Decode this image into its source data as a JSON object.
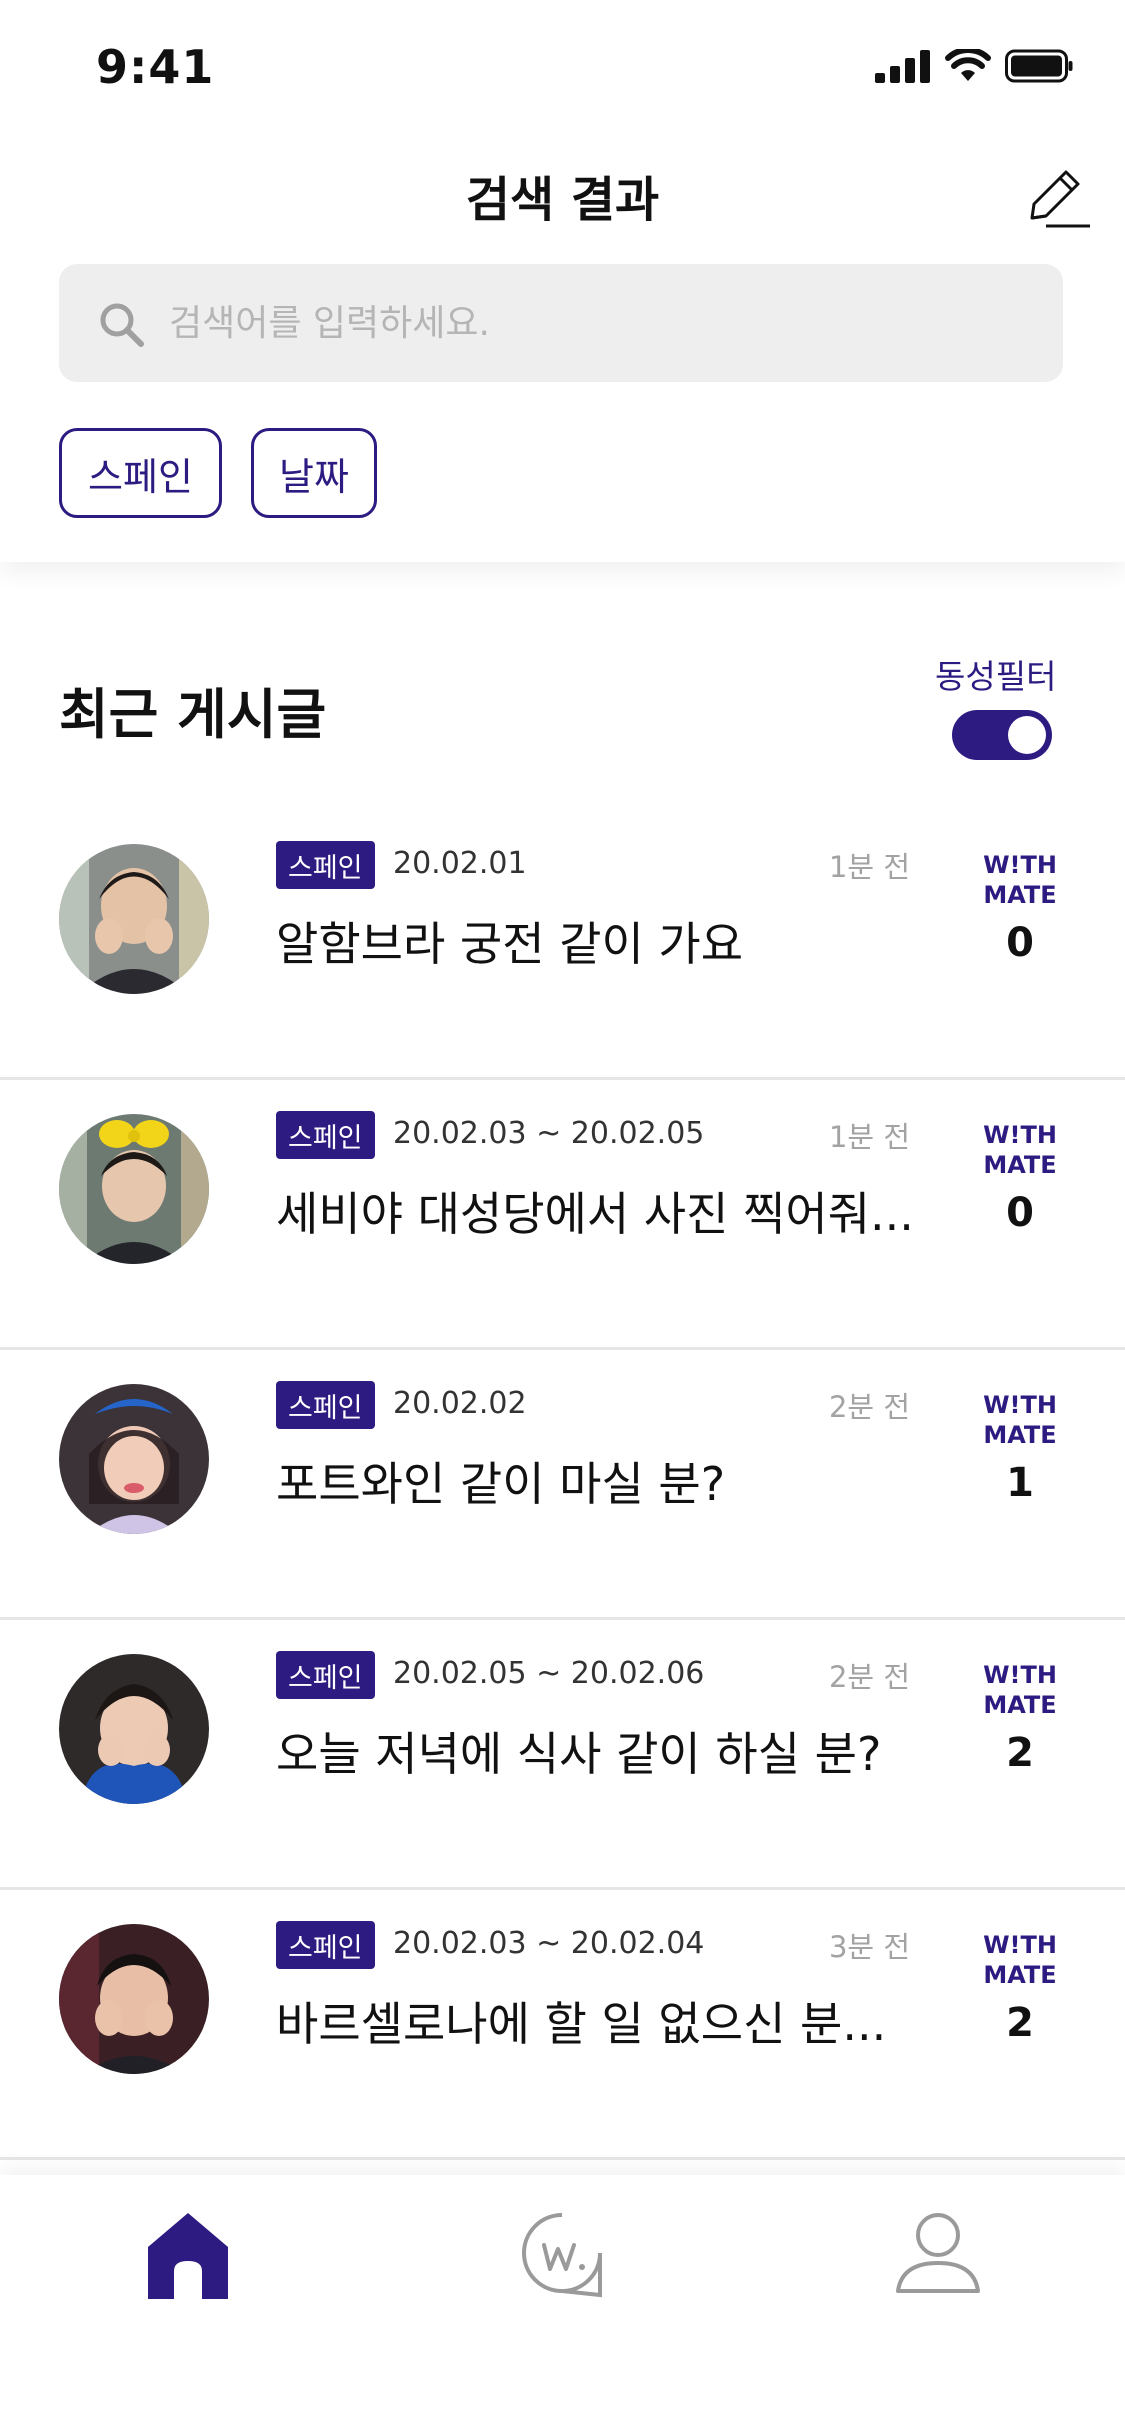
{
  "status_bar": {
    "time": "9:41"
  },
  "header": {
    "title": "검색 결과"
  },
  "search": {
    "placeholder": "검색어를 입력하세요."
  },
  "chips": [
    "스페인",
    "날짜"
  ],
  "section": {
    "title": "최근 게시글",
    "filter_label": "동성필터",
    "filter_on": true
  },
  "mate_label": {
    "line1": "W!TH",
    "line2": "MATE"
  },
  "posts": [
    {
      "tag": "스페인",
      "date": "20.02.01",
      "time_ago": "1분 전",
      "title": "알함브라 궁전 같이 가요",
      "mates": "0"
    },
    {
      "tag": "스페인",
      "date": "20.02.03 ~ 20.02.05",
      "time_ago": "1분 전",
      "title": "세비야 대성당에서 사진 찍어줘...",
      "mates": "0"
    },
    {
      "tag": "스페인",
      "date": "20.02.02",
      "time_ago": "2분 전",
      "title": "포트와인 같이 마실 분?",
      "mates": "1"
    },
    {
      "tag": "스페인",
      "date": "20.02.05 ~ 20.02.06",
      "time_ago": "2분 전",
      "title": "오늘 저녁에 식사 같이 하실 분?",
      "mates": "2"
    },
    {
      "tag": "스페인",
      "date": "20.02.03 ~ 20.02.04",
      "time_ago": "3분 전",
      "title": "바르셀로나에 할 일 없으신 분...",
      "mates": "2"
    }
  ],
  "tab_bar": {
    "active": "home",
    "icons": [
      "home-icon",
      "with-mate-icon",
      "profile-icon"
    ]
  },
  "colors": {
    "accent": "#2e1b82",
    "muted": "#a3a3a3",
    "search_bg": "#eeeeee"
  }
}
